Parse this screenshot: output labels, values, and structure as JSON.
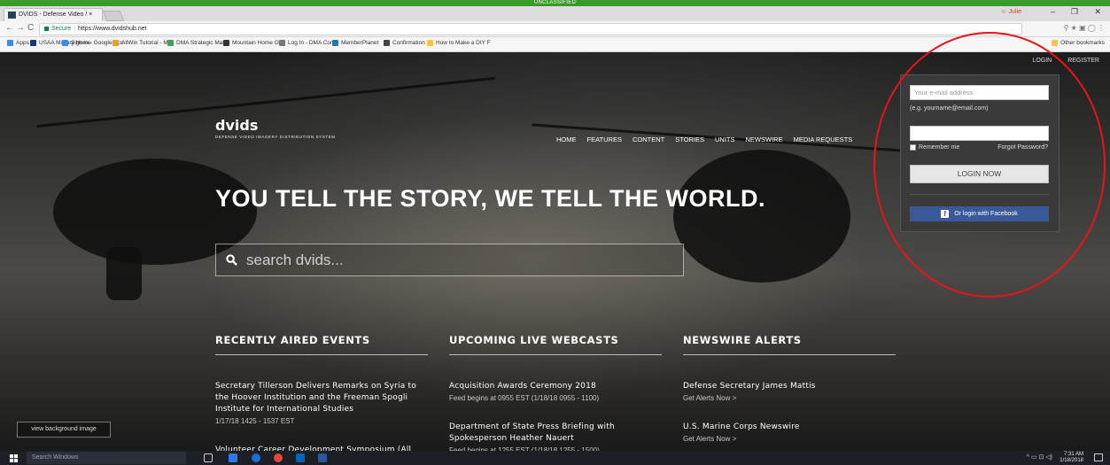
{
  "classification": "UNCLASSIFIED",
  "browser": {
    "tab_title": "DVIDS - Defense Video / ×",
    "user": "Julie",
    "url_secure_label": "Secure",
    "url": "https://www.dvidshub.net",
    "bookmarks": [
      {
        "label": "Apps",
        "color": "#4285f4"
      },
      {
        "label": "USAA Military Home",
        "color": "#1a3a6b"
      },
      {
        "label": "Sign in - Google Acc",
        "color": "#4285f4"
      },
      {
        "label": "AllWin Tutorial - Me",
        "color": "#e8a317"
      },
      {
        "label": "DMA Strategic Mana",
        "color": "#34a853"
      },
      {
        "label": "Mountain Home Ord",
        "color": "#333333"
      },
      {
        "label": "Log In - DMA Confl",
        "color": "#777777"
      },
      {
        "label": "MemberPlanet",
        "color": "#1f77b4"
      },
      {
        "label": "Confirmation",
        "color": "#444444"
      },
      {
        "label": "How to Make a DIY F",
        "color": "#f5c542"
      }
    ],
    "other_bookmarks": "Other bookmarks"
  },
  "site": {
    "top_links": {
      "login": "LOGIN",
      "register": "REGISTER"
    },
    "logo_word": "dvids",
    "logo_sub": "DEFENSE VIDEO IMAGERY DISTRIBUTION SYSTEM",
    "nav": [
      "HOME",
      "FEATURES",
      "CONTENT",
      "STORIES",
      "UNITS",
      "NEWSWIRE",
      "MEDIA REQUESTS"
    ],
    "hero": "YOU TELL THE STORY, WE TELL THE WORLD.",
    "search_placeholder": "search dvids...",
    "columns": [
      {
        "heading": "RECENTLY AIRED EVENTS",
        "items": [
          {
            "title": "Secretary Tillerson Delivers Remarks on Syria to the Hoover Institution and the Freeman Spogli Institute for International Studies",
            "sub": "1/17/18 1425 - 1537 EST"
          },
          {
            "title": "Volunteer Career Development Symposium (All",
            "sub": ""
          }
        ]
      },
      {
        "heading": "UPCOMING LIVE WEBCASTS",
        "items": [
          {
            "title": "Acquisition Awards Ceremony 2018",
            "sub": "Feed begins at 0955 EST   (1/18/18 0955 - 1100)"
          },
          {
            "title": "Department of State Press Briefing with Spokesperson Heather Nauert",
            "sub": "Feed begins at 1255 EST   (1/18/18 1255 - 1500)"
          }
        ]
      },
      {
        "heading": "NEWSWIRE ALERTS",
        "items": [
          {
            "title": "Defense Secretary James Mattis",
            "sub": "Get Alerts Now  >"
          },
          {
            "title": "U.S. Marine Corps Newswire",
            "sub": "Get Alerts Now  >"
          }
        ]
      }
    ],
    "view_background": "view background image"
  },
  "login": {
    "email_placeholder": "Your e-mail address",
    "email_hint": "(e.g. yourname@email.com)",
    "remember": "Remember me",
    "forgot": "Forgot Password?",
    "login_button": "LOGIN NOW",
    "facebook_button": "Or login with Facebook",
    "facebook_color": "#3b5998"
  },
  "annotation": {
    "color": "#e8131b"
  },
  "taskbar": {
    "search_placeholder": "Search Windows",
    "time": "7:31 AM",
    "date": "1/18/2018"
  }
}
